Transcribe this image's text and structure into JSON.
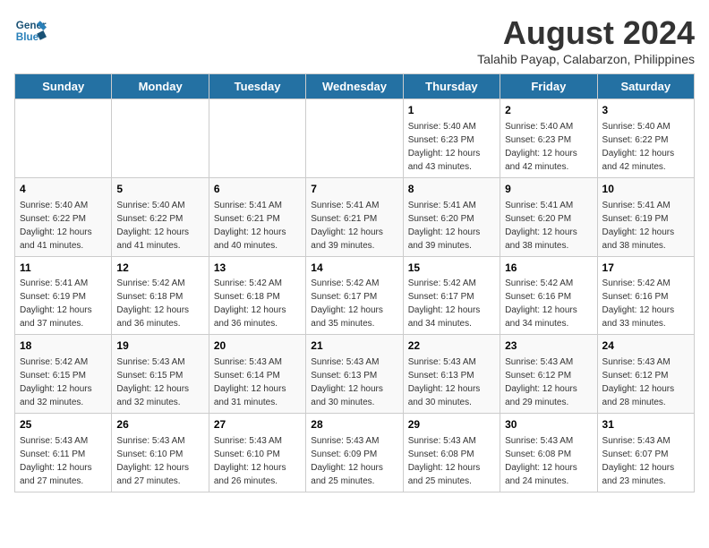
{
  "logo": {
    "line1": "General",
    "line2": "Blue"
  },
  "title": "August 2024",
  "subtitle": "Talahib Payap, Calabarzon, Philippines",
  "days_of_week": [
    "Sunday",
    "Monday",
    "Tuesday",
    "Wednesday",
    "Thursday",
    "Friday",
    "Saturday"
  ],
  "weeks": [
    [
      {
        "day": "",
        "info": ""
      },
      {
        "day": "",
        "info": ""
      },
      {
        "day": "",
        "info": ""
      },
      {
        "day": "",
        "info": ""
      },
      {
        "day": "1",
        "info": "Sunrise: 5:40 AM\nSunset: 6:23 PM\nDaylight: 12 hours\nand 43 minutes."
      },
      {
        "day": "2",
        "info": "Sunrise: 5:40 AM\nSunset: 6:23 PM\nDaylight: 12 hours\nand 42 minutes."
      },
      {
        "day": "3",
        "info": "Sunrise: 5:40 AM\nSunset: 6:22 PM\nDaylight: 12 hours\nand 42 minutes."
      }
    ],
    [
      {
        "day": "4",
        "info": "Sunrise: 5:40 AM\nSunset: 6:22 PM\nDaylight: 12 hours\nand 41 minutes."
      },
      {
        "day": "5",
        "info": "Sunrise: 5:40 AM\nSunset: 6:22 PM\nDaylight: 12 hours\nand 41 minutes."
      },
      {
        "day": "6",
        "info": "Sunrise: 5:41 AM\nSunset: 6:21 PM\nDaylight: 12 hours\nand 40 minutes."
      },
      {
        "day": "7",
        "info": "Sunrise: 5:41 AM\nSunset: 6:21 PM\nDaylight: 12 hours\nand 39 minutes."
      },
      {
        "day": "8",
        "info": "Sunrise: 5:41 AM\nSunset: 6:20 PM\nDaylight: 12 hours\nand 39 minutes."
      },
      {
        "day": "9",
        "info": "Sunrise: 5:41 AM\nSunset: 6:20 PM\nDaylight: 12 hours\nand 38 minutes."
      },
      {
        "day": "10",
        "info": "Sunrise: 5:41 AM\nSunset: 6:19 PM\nDaylight: 12 hours\nand 38 minutes."
      }
    ],
    [
      {
        "day": "11",
        "info": "Sunrise: 5:41 AM\nSunset: 6:19 PM\nDaylight: 12 hours\nand 37 minutes."
      },
      {
        "day": "12",
        "info": "Sunrise: 5:42 AM\nSunset: 6:18 PM\nDaylight: 12 hours\nand 36 minutes."
      },
      {
        "day": "13",
        "info": "Sunrise: 5:42 AM\nSunset: 6:18 PM\nDaylight: 12 hours\nand 36 minutes."
      },
      {
        "day": "14",
        "info": "Sunrise: 5:42 AM\nSunset: 6:17 PM\nDaylight: 12 hours\nand 35 minutes."
      },
      {
        "day": "15",
        "info": "Sunrise: 5:42 AM\nSunset: 6:17 PM\nDaylight: 12 hours\nand 34 minutes."
      },
      {
        "day": "16",
        "info": "Sunrise: 5:42 AM\nSunset: 6:16 PM\nDaylight: 12 hours\nand 34 minutes."
      },
      {
        "day": "17",
        "info": "Sunrise: 5:42 AM\nSunset: 6:16 PM\nDaylight: 12 hours\nand 33 minutes."
      }
    ],
    [
      {
        "day": "18",
        "info": "Sunrise: 5:42 AM\nSunset: 6:15 PM\nDaylight: 12 hours\nand 32 minutes."
      },
      {
        "day": "19",
        "info": "Sunrise: 5:43 AM\nSunset: 6:15 PM\nDaylight: 12 hours\nand 32 minutes."
      },
      {
        "day": "20",
        "info": "Sunrise: 5:43 AM\nSunset: 6:14 PM\nDaylight: 12 hours\nand 31 minutes."
      },
      {
        "day": "21",
        "info": "Sunrise: 5:43 AM\nSunset: 6:13 PM\nDaylight: 12 hours\nand 30 minutes."
      },
      {
        "day": "22",
        "info": "Sunrise: 5:43 AM\nSunset: 6:13 PM\nDaylight: 12 hours\nand 30 minutes."
      },
      {
        "day": "23",
        "info": "Sunrise: 5:43 AM\nSunset: 6:12 PM\nDaylight: 12 hours\nand 29 minutes."
      },
      {
        "day": "24",
        "info": "Sunrise: 5:43 AM\nSunset: 6:12 PM\nDaylight: 12 hours\nand 28 minutes."
      }
    ],
    [
      {
        "day": "25",
        "info": "Sunrise: 5:43 AM\nSunset: 6:11 PM\nDaylight: 12 hours\nand 27 minutes."
      },
      {
        "day": "26",
        "info": "Sunrise: 5:43 AM\nSunset: 6:10 PM\nDaylight: 12 hours\nand 27 minutes."
      },
      {
        "day": "27",
        "info": "Sunrise: 5:43 AM\nSunset: 6:10 PM\nDaylight: 12 hours\nand 26 minutes."
      },
      {
        "day": "28",
        "info": "Sunrise: 5:43 AM\nSunset: 6:09 PM\nDaylight: 12 hours\nand 25 minutes."
      },
      {
        "day": "29",
        "info": "Sunrise: 5:43 AM\nSunset: 6:08 PM\nDaylight: 12 hours\nand 25 minutes."
      },
      {
        "day": "30",
        "info": "Sunrise: 5:43 AM\nSunset: 6:08 PM\nDaylight: 12 hours\nand 24 minutes."
      },
      {
        "day": "31",
        "info": "Sunrise: 5:43 AM\nSunset: 6:07 PM\nDaylight: 12 hours\nand 23 minutes."
      }
    ]
  ]
}
